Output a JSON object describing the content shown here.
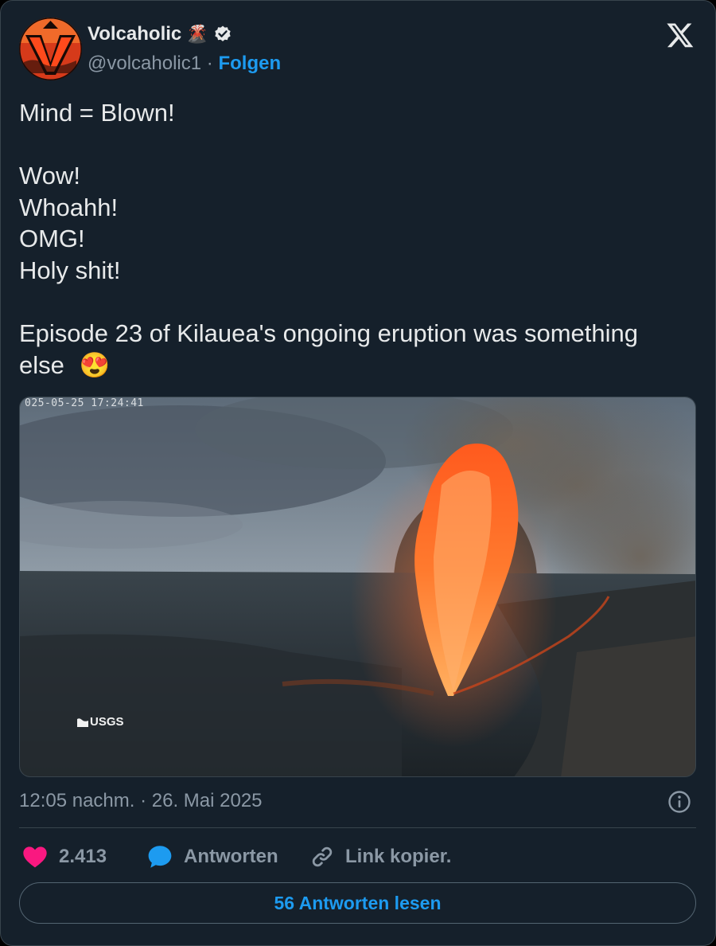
{
  "author": {
    "name": "Volcaholic",
    "name_emoji": "🌋",
    "verified": true,
    "handle": "@volcaholic1",
    "separator": "·",
    "follow_label": "Folgen"
  },
  "tweet": {
    "paragraphs": [
      [
        "Mind = Blown!"
      ],
      [
        "Wow!",
        "Whoahh!",
        "OMG!",
        "Holy shit!"
      ],
      [
        "Episode 23 of Kilauea's ongoing eruption was something else"
      ]
    ],
    "end_emoji": "😍"
  },
  "media": {
    "overlay_timestamp": "025-05-25 17:24:41",
    "watermark": "USGS"
  },
  "meta": {
    "date": "12:05 nachm. · 26. Mai 2025"
  },
  "actions": {
    "like_count": "2.413",
    "reply_label": "Antworten",
    "copy_link_label": "Link kopier."
  },
  "read_replies_label": "56 Antworten lesen",
  "colors": {
    "background": "#15202b",
    "accent": "#1d9bf0",
    "like": "#f91880",
    "secondary_text": "#8b98a5",
    "primary_text": "#e7e9ea"
  },
  "icons": {
    "close": "x-logo-icon",
    "verified": "verified-badge-icon",
    "info": "info-icon",
    "like": "heart-icon",
    "reply": "speech-bubble-icon",
    "link": "link-icon"
  }
}
